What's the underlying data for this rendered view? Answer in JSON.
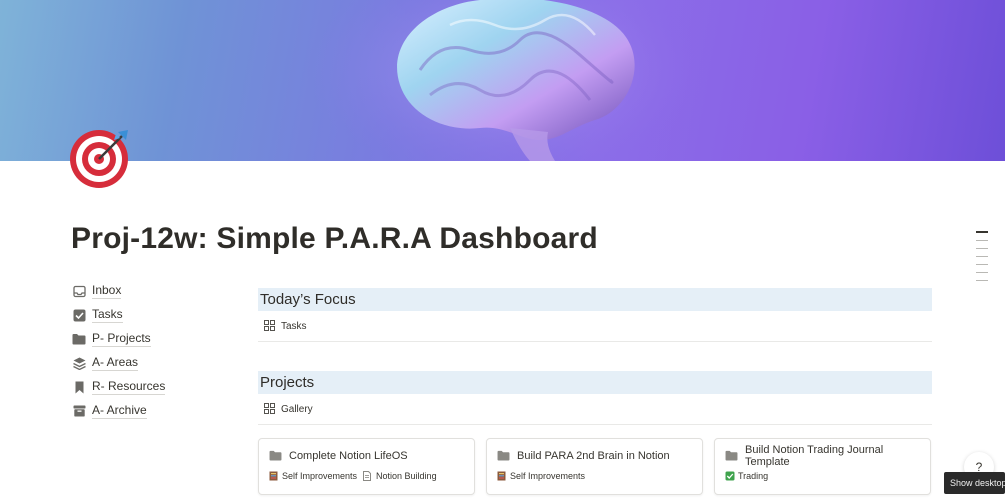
{
  "page": {
    "title": "Proj-12w: Simple P.A.R.A Dashboard",
    "icon": "target-icon",
    "cover": "brain-cover"
  },
  "sidebar": {
    "items": [
      {
        "label": "Inbox",
        "icon": "inbox-icon"
      },
      {
        "label": "Tasks",
        "icon": "checkbox-icon"
      },
      {
        "label": "P- Projects",
        "icon": "folder-icon"
      },
      {
        "label": "A- Areas",
        "icon": "layers-icon"
      },
      {
        "label": "R- Resources",
        "icon": "bookmark-icon"
      },
      {
        "label": "A- Archive",
        "icon": "archive-icon"
      }
    ]
  },
  "todays_focus": {
    "heading": "Today’s Focus",
    "view_label": "Tasks"
  },
  "projects": {
    "heading": "Projects",
    "view_label": "Gallery",
    "cards": [
      {
        "title": "Complete Notion LifeOS",
        "tags": [
          {
            "label": "Self Improvements",
            "icon": "book-icon"
          },
          {
            "label": "Notion Building",
            "icon": "document-icon"
          }
        ]
      },
      {
        "title": "Build PARA 2nd Brain in Notion",
        "tags": [
          {
            "label": "Self Improvements",
            "icon": "book-icon"
          }
        ]
      },
      {
        "title": "Build Notion Trading Journal Template",
        "tags": [
          {
            "label": "Trading",
            "icon": "checkbox-icon"
          }
        ]
      }
    ]
  },
  "help": {
    "tooltip": "Show desktop",
    "icon": "help-icon"
  },
  "colors": {
    "section_bg": "#e5eff7",
    "text": "#37352f",
    "target_red": "#d62d3b",
    "dart_blue": "#3a8fd6"
  }
}
